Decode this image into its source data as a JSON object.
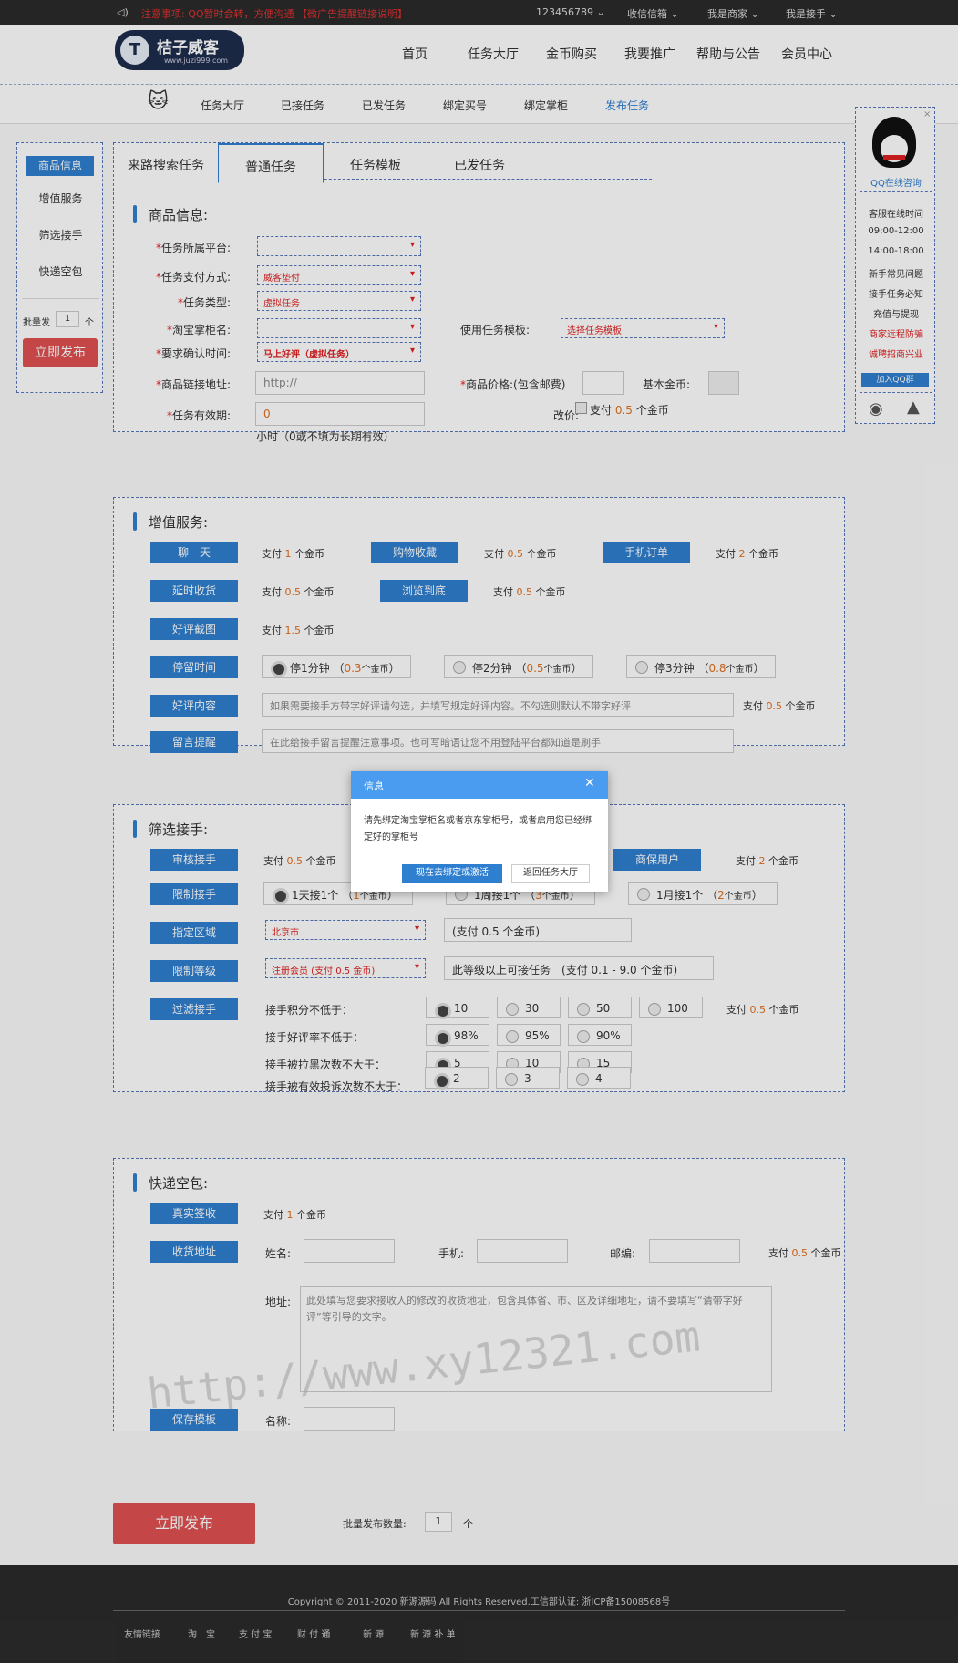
{
  "topbar": {
    "notice": "注意事项: QQ暂时会转，方便沟通 【微广告提醒链接说明】",
    "user": "123456789",
    "inbox": "收信信箱",
    "merchant": "我是商家",
    "worker": "我是接手"
  },
  "header": {
    "logo_title": "桔子威客",
    "logo_url": "www.juzi999.com",
    "nav": [
      "首页",
      "任务大厅",
      "金币购买",
      "我要推广",
      "帮助与公告",
      "会员中心"
    ]
  },
  "subnav": [
    "任务大厅",
    "已接任务",
    "已发任务",
    "绑定买号",
    "绑定掌柜",
    "发布任务"
  ],
  "sidebar": {
    "items": [
      "商品信息",
      "增值服务",
      "筛选接手",
      "快递空包"
    ],
    "batch_label": "批量发",
    "batch_value": "1",
    "batch_unit": "个",
    "publish": "立即发布"
  },
  "tabs": [
    "来路搜索任务",
    "普通任务",
    "任务模板",
    "已发任务"
  ],
  "product": {
    "title": "商品信息:",
    "platform_label": "任务所属平台:",
    "platform_value": "",
    "pay_label": "任务支付方式:",
    "pay_value": "威客垫付",
    "type_label": "任务类型:",
    "type_value": "虚拟任务",
    "shop_label": "淘宝掌柜名:",
    "shop_value": "",
    "confirm_label": "要求确认时间:",
    "confirm_value": "马上好评（虚拟任务）",
    "template_label": "使用任务模板:",
    "template_value": "选择任务模板",
    "link_label": "商品链接地址:",
    "link_value": "http://",
    "price_label": "商品价格:(包含邮费)",
    "base_label": "基本金币:",
    "valid_label": "任务有效期:",
    "valid_value": "0",
    "valid_hint": "小时（0或不填为长期有效）",
    "reprice_label": "改价:",
    "reprice_text_a": "支付",
    "reprice_amount": "0.5",
    "reprice_text_b": "个金币"
  },
  "service": {
    "title": "增值服务:",
    "pay_word": "支付",
    "unit_word": "个金币",
    "b1": "聊　天",
    "p1": "1",
    "b2": "购物收藏",
    "p2": "0.5",
    "b3": "手机订单",
    "p3": "2",
    "b4": "延时收货",
    "p4": "0.5",
    "b5": "浏览到底",
    "p5": "0.5",
    "b6": "好评截图",
    "p6": "1.5",
    "b7": "停留时间",
    "stay": [
      {
        "label": "停1分钟",
        "price": "0.3"
      },
      {
        "label": "停2分钟",
        "price": "0.5"
      },
      {
        "label": "停3分钟",
        "price": "0.8"
      }
    ],
    "b8": "好评内容",
    "review_hint": "如果需要接手方带字好评请勾选，并填写规定好评内容。不勾选则默认不带字好评",
    "p8": "0.5",
    "b9": "留言提醒",
    "note_hint": "在此给接手留言提醒注意事项。也可写暗语让您不用登陆平台都知道是刷手"
  },
  "filter": {
    "title": "筛选接手:",
    "b1": "审核接手",
    "p1": "0.5",
    "b_right": "商保用户",
    "p_right": "2",
    "b2": "限制接手",
    "limit": [
      {
        "label": "1天接1个",
        "price": "1"
      },
      {
        "label": "1周接1个",
        "price": "3"
      },
      {
        "label": "1月接1个",
        "price": "2"
      }
    ],
    "b3": "指定区域",
    "region": "北京市",
    "region_pay": "(支付 0.5 个金币)",
    "b4": "限制等级",
    "level": "注册会员 (支付 0.5 金币)",
    "level_text": "此等级以上可接任务",
    "level_pay": "(支付 0.1 - 9.0 个金币)",
    "b5": "过滤接手",
    "score_label": "接手积分不低于：",
    "score": [
      "10",
      "30",
      "50",
      "100"
    ],
    "score_pay": "0.5",
    "rate_label": "接手好评率不低于：",
    "rate": [
      "98%",
      "95%",
      "90%"
    ],
    "black_label": "接手被拉黑次数不大于：",
    "black": [
      "5",
      "10",
      "15"
    ],
    "complain_label": "接手被有效投诉次数不大于：",
    "complain": [
      "2",
      "3",
      "4"
    ]
  },
  "express": {
    "title": "快递空包:",
    "b1": "真实签收",
    "p1": "1",
    "b2": "收货地址",
    "p2": "0.5",
    "name_label": "姓名:",
    "phone_label": "手机:",
    "zip_label": "邮编:",
    "addr_label": "地址:",
    "addr_hint": "此处填写您要求接收人的修改的收货地址，包含具体省、市、区及详细地址，请不要填写“请带字好评”等引导的文字。",
    "b3": "保存模板",
    "tname_label": "名称:"
  },
  "bottom": {
    "publish": "立即发布",
    "batch_label": "批量发布数量:",
    "batch_value": "1",
    "batch_unit": "个"
  },
  "qq": {
    "consult": "QQ在线咨询",
    "hours_label": "客服在线时间",
    "h1": "09:00-12:00",
    "h2": "14:00-18:00",
    "l1": "新手常见问题",
    "l2": "接手任务必知",
    "l3": "充值与提现",
    "l4": "商家远程防骗",
    "l5": "诚聘招商兴业",
    "join": "加入QQ群"
  },
  "dialog": {
    "title": "信息",
    "message": "请先绑定淘宝掌柜名或者京东掌柜号，或者启用您已经绑定好的掌柜号",
    "confirm": "现在去绑定或激活",
    "cancel": "返回任务大厅"
  },
  "watermark": "http://www.xy12321.com",
  "footer": {
    "copyright": "Copyright © 2011-2020 新源源码 All Rights Reserved.工信部认证: 浙ICP备15008568号",
    "links": [
      "友情链接",
      "淘　宝",
      "支 付 宝",
      "财 付 通",
      "新 源",
      "新 源 补 单"
    ]
  }
}
